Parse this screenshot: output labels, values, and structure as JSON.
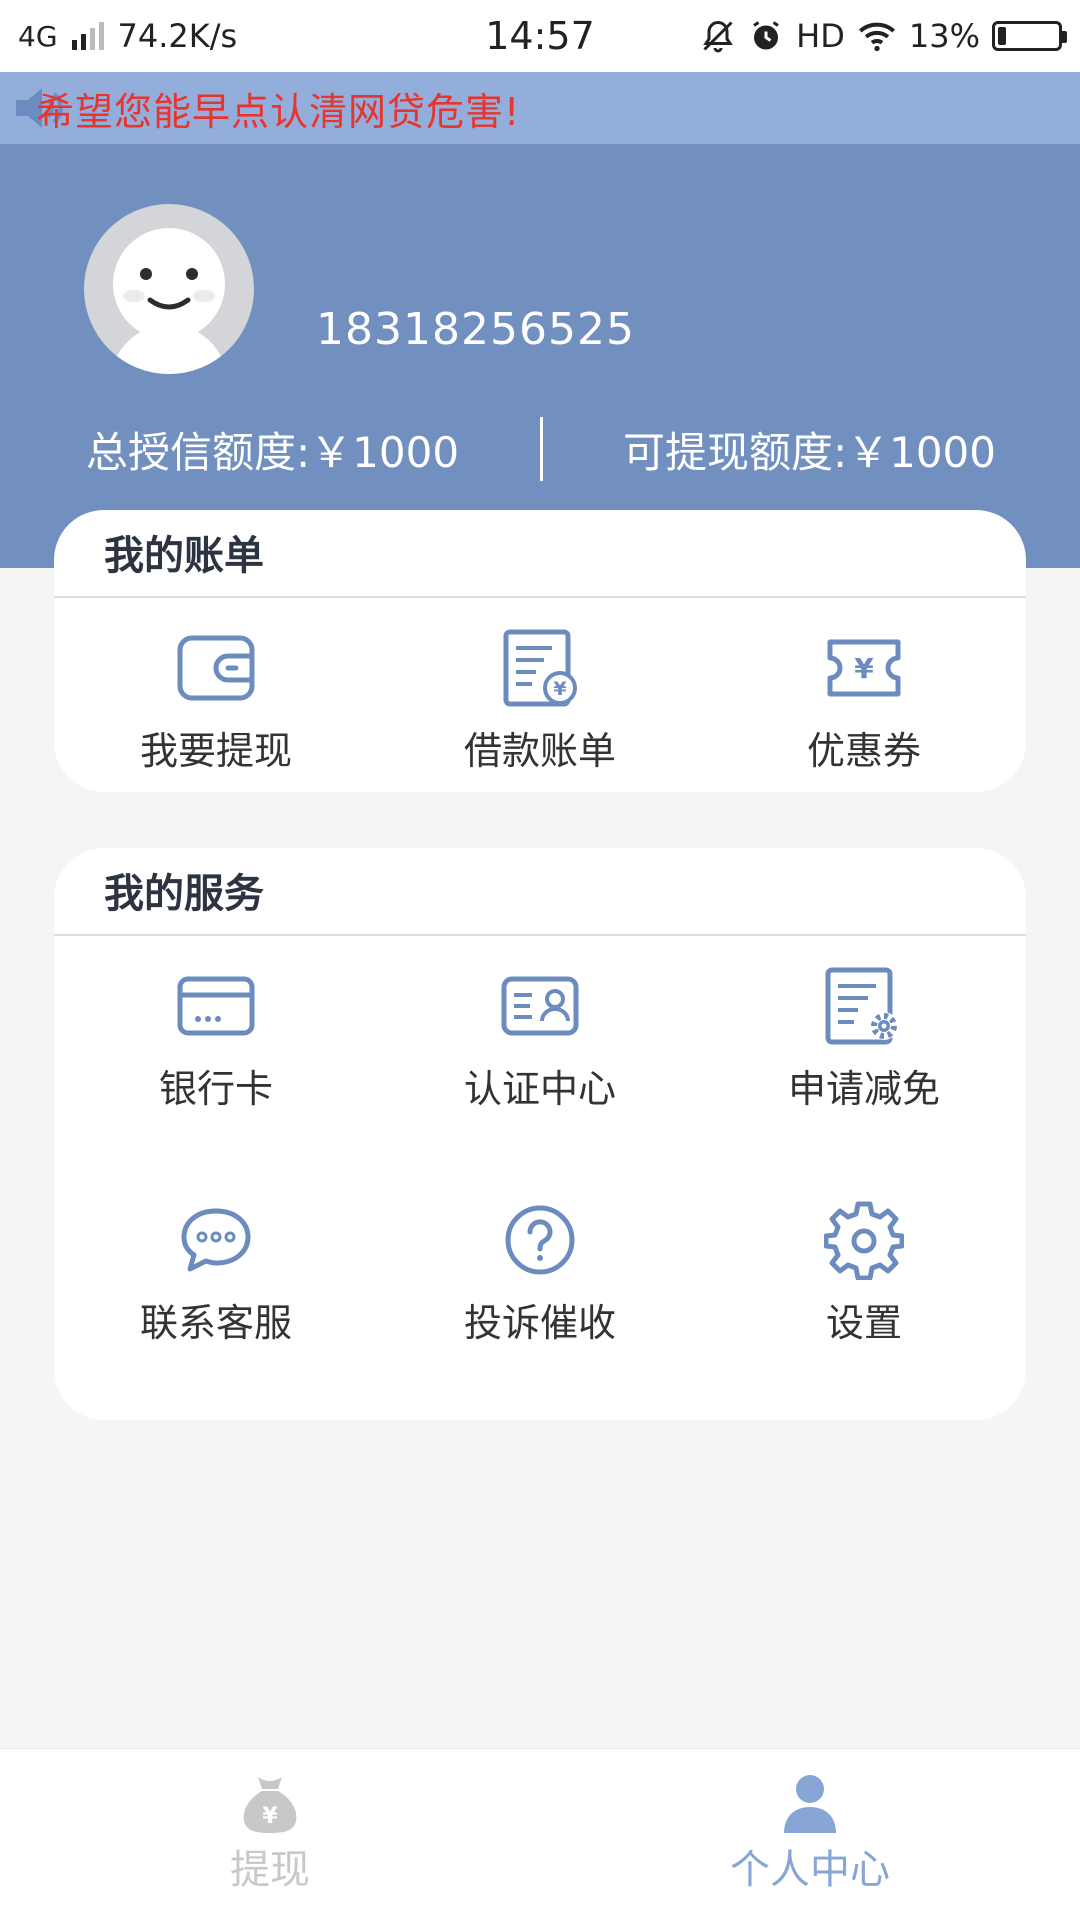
{
  "status_bar": {
    "network": "4G",
    "speed": "74.2K/s",
    "time": "14:57",
    "hd": "HD",
    "battery": "13%",
    "battery_level": 0.13
  },
  "notice": {
    "text": "希望您能早点认清网贷危害!"
  },
  "profile": {
    "phone": "18318256525",
    "total_credit": "总授信额度:￥1000",
    "available": "可提现额度:￥1000"
  },
  "bills": {
    "title": "我的账单",
    "items": [
      {
        "label": "我要提现"
      },
      {
        "label": "借款账单"
      },
      {
        "label": "优惠券"
      }
    ]
  },
  "services": {
    "title": "我的服务",
    "items": [
      {
        "label": "银行卡"
      },
      {
        "label": "认证中心"
      },
      {
        "label": "申请减免"
      },
      {
        "label": "联系客服"
      },
      {
        "label": "投诉催收"
      },
      {
        "label": "设置"
      }
    ]
  },
  "tabs": [
    {
      "label": "提现",
      "active": false
    },
    {
      "label": "个人中心",
      "active": true
    }
  ],
  "colors": {
    "header_bg": "#7190c0",
    "notice_bg": "#93aedb",
    "notice_text": "#e8342f",
    "icon": "#6c8cbf",
    "tab_inactive": "#c8c8c8",
    "tab_active": "#87a6d6"
  }
}
